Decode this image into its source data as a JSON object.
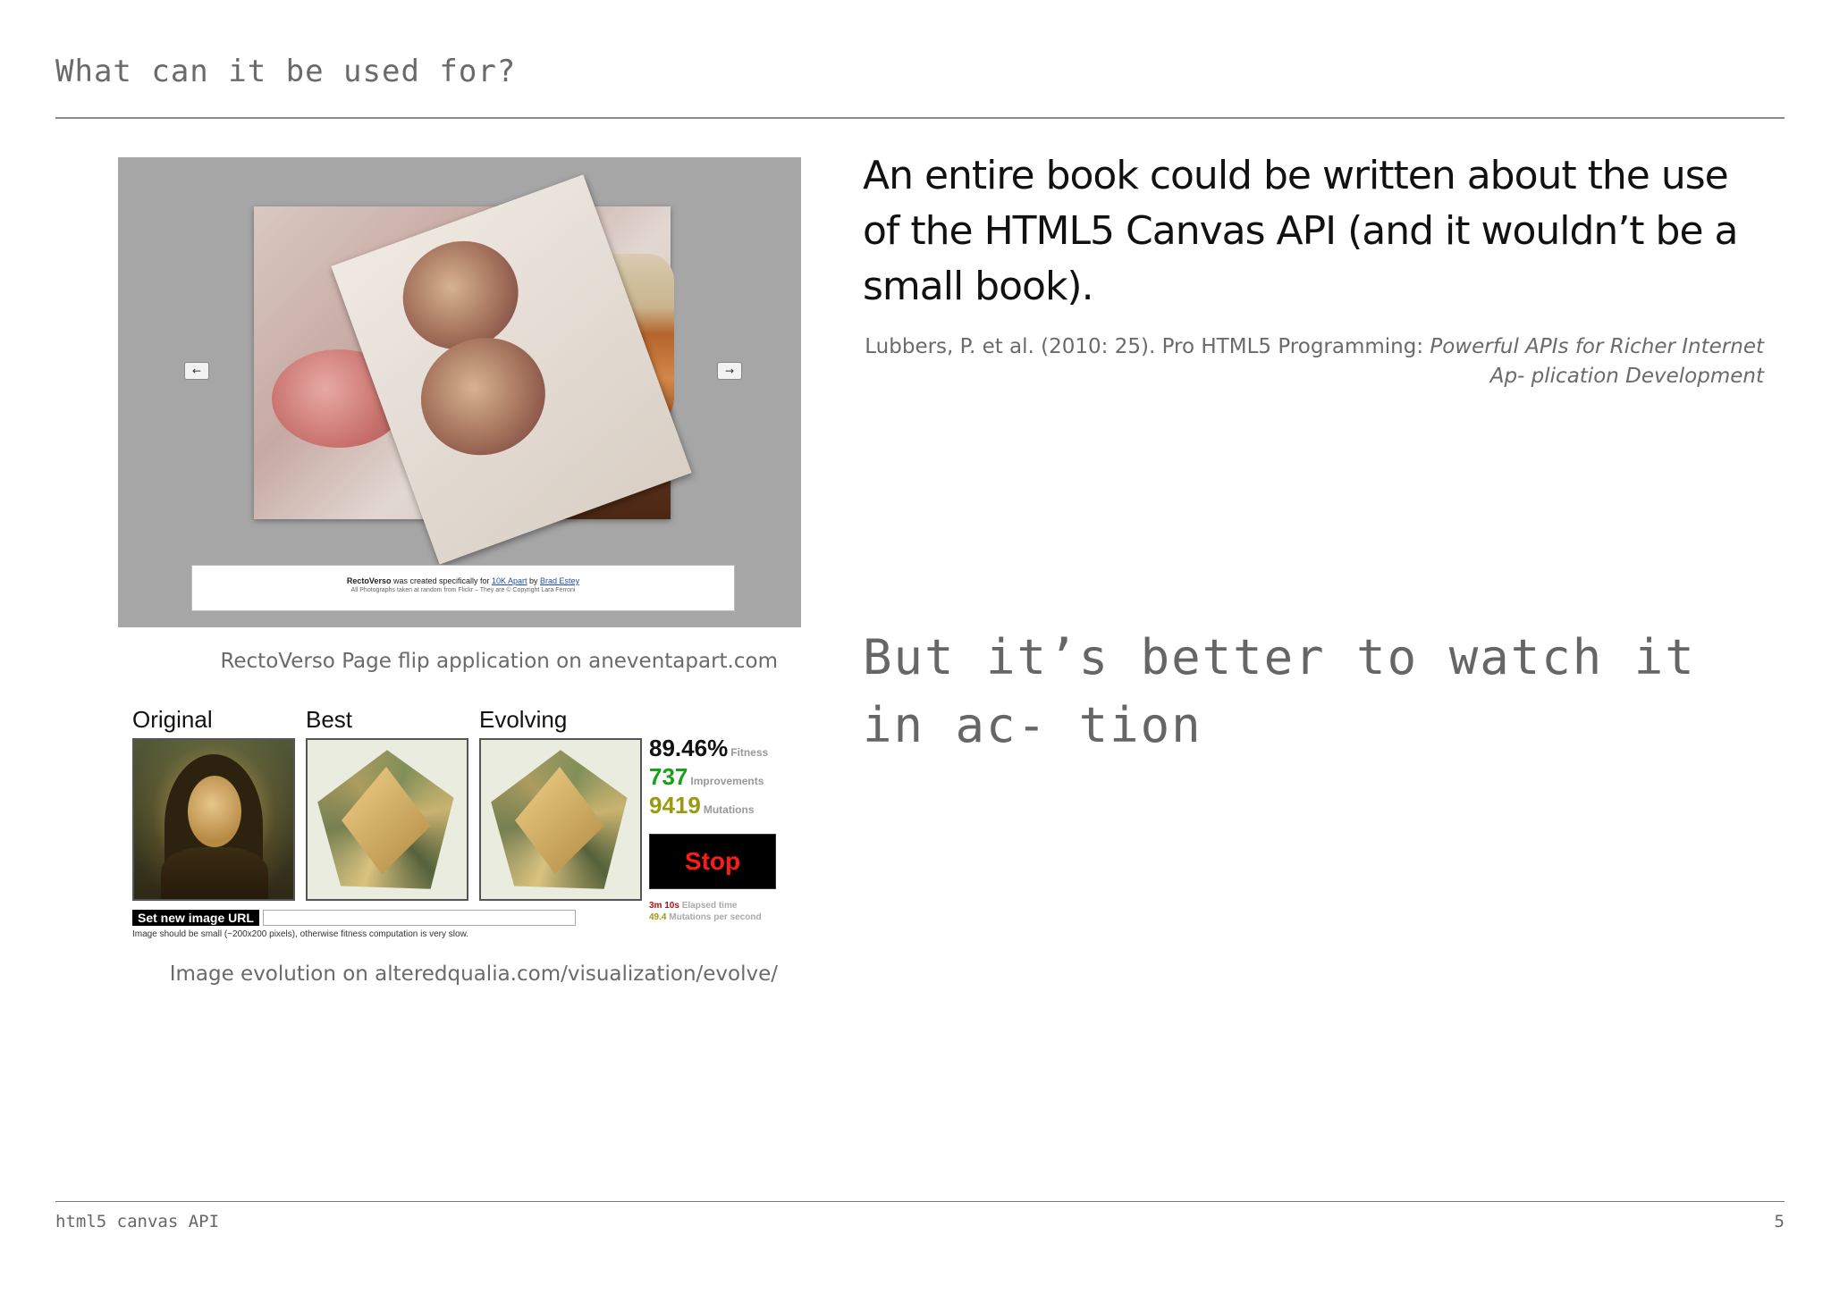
{
  "slide": {
    "title": "What can it be used for?",
    "quote": "An entire book could be written about the use of the HTML5 Canvas API (and it wouldn’t be a small book).",
    "citation_plain": "Lubbers, P. et al. (2010: 25). Pro HTML5 Programming: ",
    "citation_italic": "Powerful APIs for Richer Internet Ap- plication Development",
    "watch_text": "But it’s better to watch it in ac- tion",
    "footer_left": "html5 canvas API",
    "page_number": "5"
  },
  "rectoverso": {
    "caption": "RectoVerso Page flip application on aneventapart.com",
    "prev_arrow": "←",
    "next_arrow": "→",
    "credit_name": "RectoVerso",
    "credit_mid": " was created specifically for ",
    "credit_link1": "10K Apart",
    "credit_by": " by ",
    "credit_link2": "Brad Estey",
    "credit_line2": "All Photographs taken at random from Flickr – They are © Copyright Lara Ferroni"
  },
  "evolve": {
    "caption": "Image evolution on alteredqualia.com/visualization/evolve/",
    "label_original": "Original",
    "label_best": "Best",
    "label_evolving": "Evolving",
    "fitness_value": "89.46%",
    "fitness_label": "Fitness",
    "improvements_value": "737",
    "improvements_label": "Improvements",
    "mutations_value": "9419",
    "mutations_label": "Mutations",
    "stop_label": "Stop",
    "elapsed_value": "3m 10s",
    "elapsed_label": "Elapsed time",
    "rate_value": "49.4",
    "rate_label": "Mutations per second",
    "url_button": "Set new image URL",
    "url_hint": "Image should be small (~200x200 pixels), otherwise fitness computation is very slow."
  }
}
